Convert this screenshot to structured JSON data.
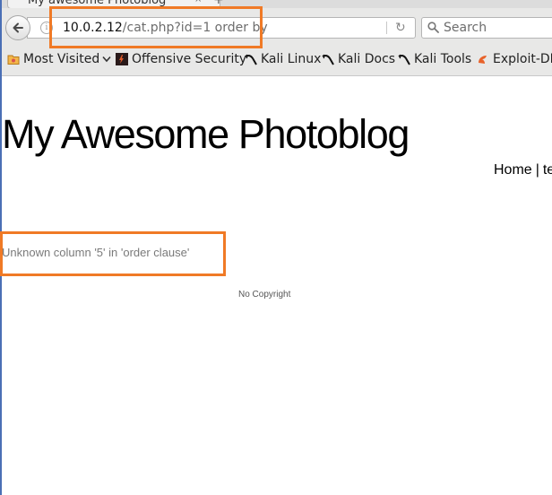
{
  "browser": {
    "tab_title": "My awesome Photoblog",
    "tab_close": "×",
    "new_tab": "+",
    "url_host": "10.0.2.12",
    "url_path": "/cat.php?id=1 order by",
    "search_placeholder": "Search",
    "icons": {
      "back": "back-arrow-icon",
      "info": "info-icon",
      "reload": "reload-icon",
      "search": "search-icon"
    }
  },
  "bookmarks": [
    {
      "label": "Most Visited",
      "icon": "folder-icon"
    },
    {
      "label": "Offensive Security",
      "icon": "offsec-icon"
    },
    {
      "label": "Kali Linux",
      "icon": "kali-dragon-icon"
    },
    {
      "label": "Kali Docs",
      "icon": "kali-dragon-icon"
    },
    {
      "label": "Kali Tools",
      "icon": "kali-dragon-icon"
    },
    {
      "label": "Exploit-DB",
      "icon": "exploit-db-icon"
    }
  ],
  "page": {
    "title": "My Awesome Photoblog",
    "nav": {
      "home": "Home",
      "separator": "|",
      "next": "te"
    },
    "error_message": "Unknown column '5' in 'order clause'",
    "footer": "No Copyright"
  },
  "colors": {
    "highlight": "#f07a26",
    "chrome_bg": "#e8e8e7",
    "url_path": "#6d6d6d",
    "error_text": "#7a7a7a"
  }
}
